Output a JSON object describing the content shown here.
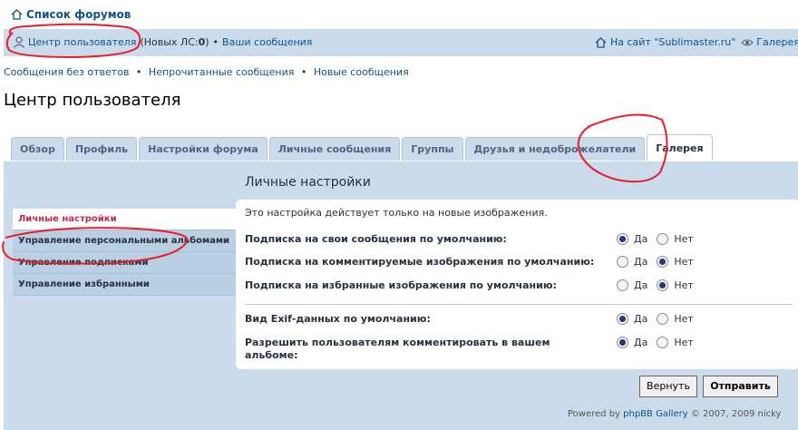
{
  "header": {
    "forum_list": "Список форумов"
  },
  "navbar": {
    "ucp": "Центр пользователя",
    "new_pm_prefix": "(Новых ЛС: ",
    "new_pm_count": "0",
    "new_pm_suffix": ")",
    "bullet": "•",
    "your_posts": "Ваши сообщения",
    "to_site": "На сайт \"Sublimaster.ru\"",
    "gallery": "Галерея"
  },
  "sublinks": {
    "unanswered": "Сообщения без ответов",
    "unread": "Непрочитанные сообщения",
    "new": "Новые сообщения",
    "bullet": "•"
  },
  "page_title": "Центр пользователя",
  "tabs": [
    {
      "label": "Обзор",
      "active": false
    },
    {
      "label": "Профиль",
      "active": false
    },
    {
      "label": "Настройки форума",
      "active": false
    },
    {
      "label": "Личные сообщения",
      "active": false
    },
    {
      "label": "Группы",
      "active": false
    },
    {
      "label": "Друзья и недоброжелатели",
      "active": false
    },
    {
      "label": "Галерея",
      "active": true
    }
  ],
  "menu": [
    {
      "label": "Личные настройки",
      "active": true
    },
    {
      "label": "Управление персональными альбомами",
      "active": false
    },
    {
      "label": "Управление подписками",
      "active": false
    },
    {
      "label": "Управление избранными",
      "active": false
    }
  ],
  "content": {
    "title": "Личные настройки",
    "note": "Это настройка действует только на новые изображения.",
    "yes": "Да",
    "no": "Нет",
    "settings": [
      {
        "label": "Подписка на свои сообщения по умолчанию:",
        "value": "yes"
      },
      {
        "label": "Подписка на комментируемые изображения по умолчанию:",
        "value": "no"
      },
      {
        "label": "Подписка на избранные изображения по умолчанию:",
        "value": "no"
      },
      {
        "label": "Вид Exif-данных по умолчанию:",
        "value": "yes"
      },
      {
        "label": "Разрешить пользователям комментировать в вашем альбоме:",
        "value": "yes"
      }
    ]
  },
  "buttons": {
    "reset": "Вернуть",
    "submit": "Отправить"
  },
  "footer": {
    "prefix": "Powered by ",
    "link": "phpBB Gallery",
    "suffix": " © 2007, 2009 nicky"
  },
  "colors": {
    "nav_bg": "#cadceb",
    "link": "#105289",
    "active_menu": "#bc2a4d",
    "annotation": "#ee1c24"
  }
}
